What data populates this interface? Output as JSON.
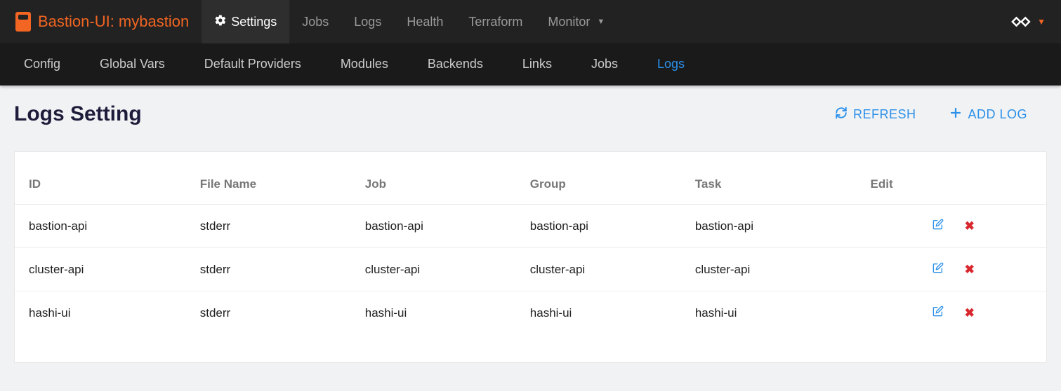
{
  "brand": {
    "name": "Bastion-UI: mybastion"
  },
  "topnav": {
    "items": [
      {
        "label": "Settings",
        "active": true,
        "icon": "gear"
      },
      {
        "label": "Jobs"
      },
      {
        "label": "Logs"
      },
      {
        "label": "Health"
      },
      {
        "label": "Terraform"
      },
      {
        "label": "Monitor",
        "dropdown": true
      }
    ]
  },
  "subnav": {
    "items": [
      {
        "label": "Config"
      },
      {
        "label": "Global Vars"
      },
      {
        "label": "Default Providers"
      },
      {
        "label": "Modules"
      },
      {
        "label": "Backends"
      },
      {
        "label": "Links"
      },
      {
        "label": "Jobs"
      },
      {
        "label": "Logs",
        "active": true
      }
    ]
  },
  "page": {
    "title": "Logs Setting",
    "refresh_label": "REFRESH",
    "add_label": "ADD LOG"
  },
  "table": {
    "headers": {
      "id": "ID",
      "file": "File Name",
      "job": "Job",
      "group": "Group",
      "task": "Task",
      "edit": "Edit"
    },
    "rows": [
      {
        "id": "bastion-api",
        "file": "stderr",
        "job": "bastion-api",
        "group": "bastion-api",
        "task": "bastion-api"
      },
      {
        "id": "cluster-api",
        "file": "stderr",
        "job": "cluster-api",
        "group": "cluster-api",
        "task": "cluster-api"
      },
      {
        "id": "hashi-ui",
        "file": "stderr",
        "job": "hashi-ui",
        "group": "hashi-ui",
        "task": "hashi-ui"
      }
    ]
  }
}
